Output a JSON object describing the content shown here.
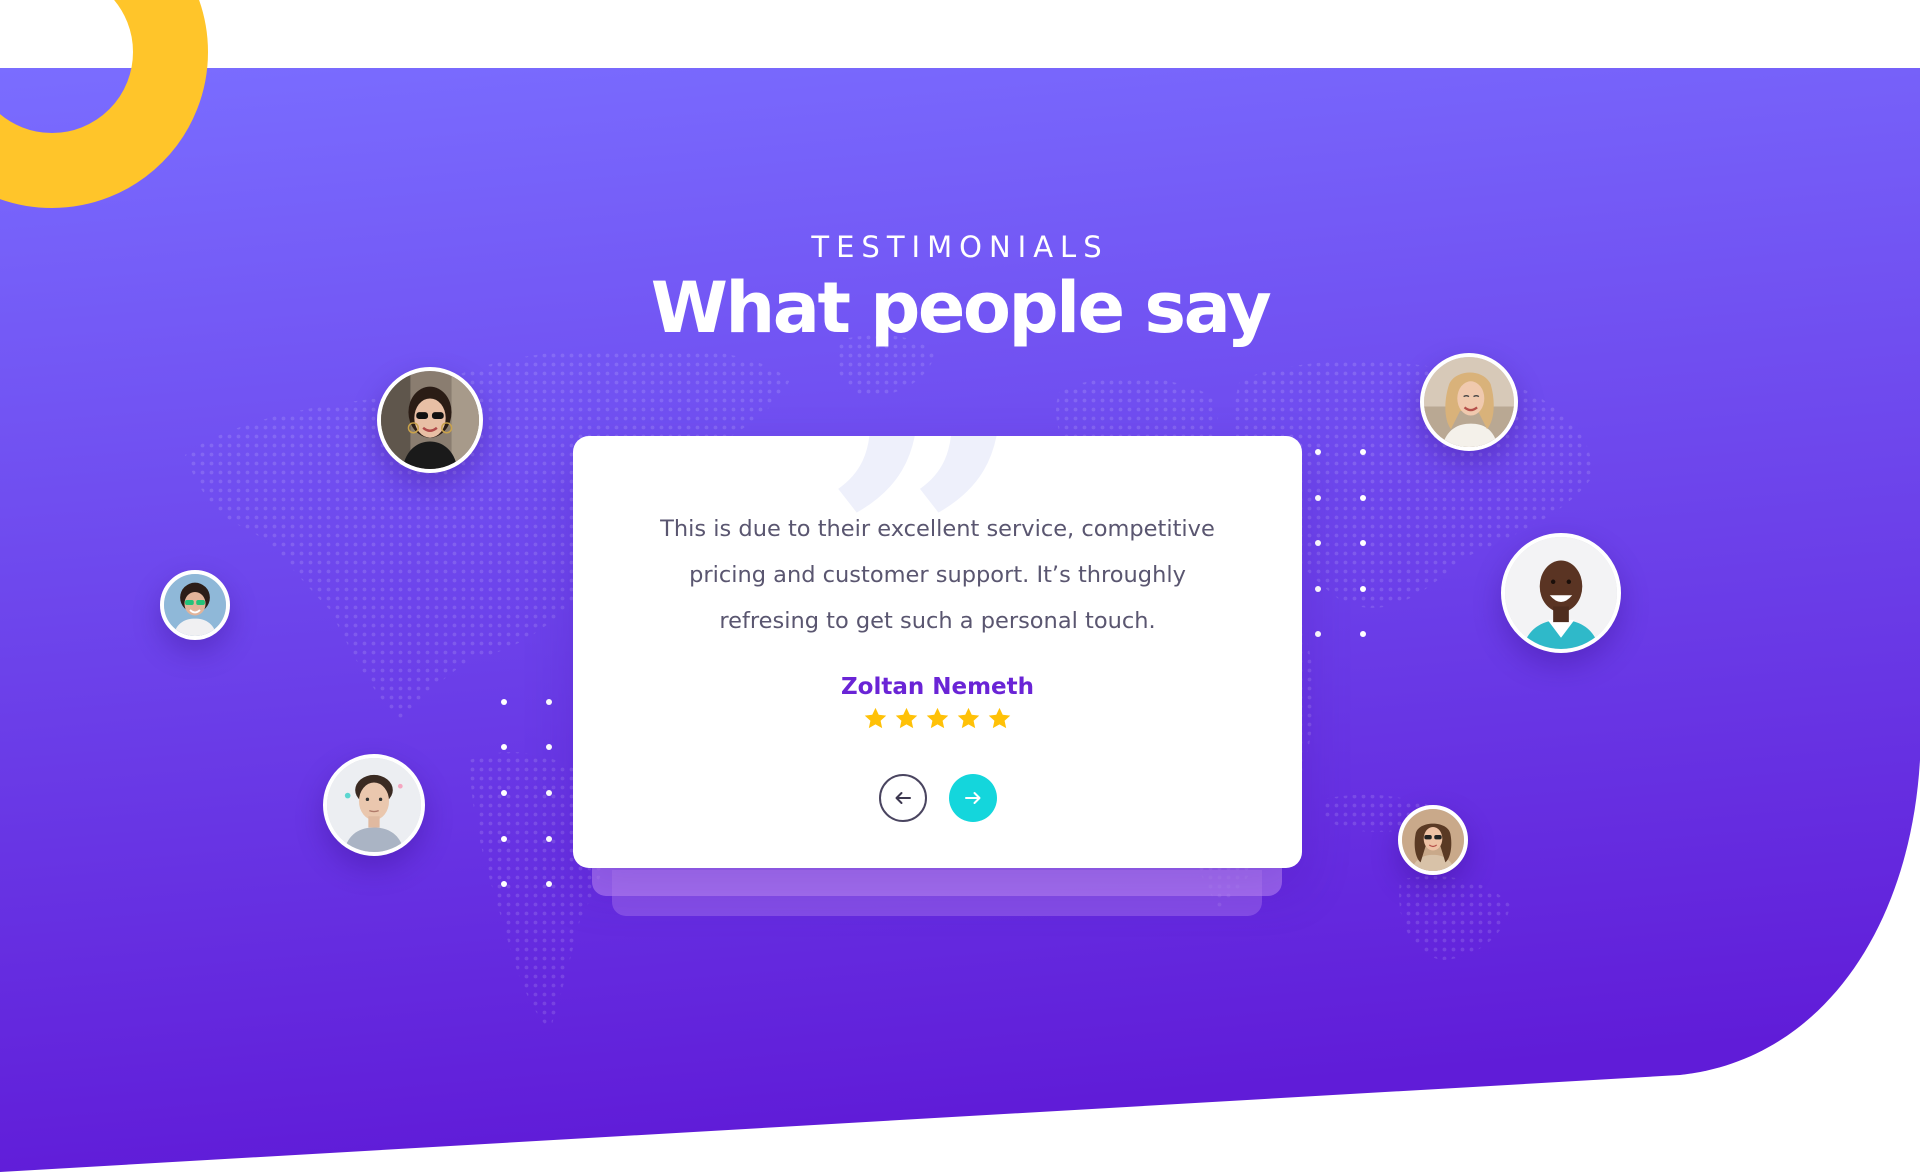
{
  "section": {
    "eyebrow": "TESTIMONIALS",
    "headline": "What people say"
  },
  "testimonial": {
    "quote_line_1": "This is due to their excellent service, competitive",
    "quote_line_2": "pricing and customer support. It’s throughly",
    "quote_line_3": "refresing to get such a personal touch.",
    "author": "Zoltan Nemeth",
    "rating": 5,
    "rating_max": 5
  },
  "navigation": {
    "prev_icon": "arrow-left-icon",
    "next_icon": "arrow-right-icon"
  },
  "colors": {
    "gradient_top": "#7a6dff",
    "gradient_bottom": "#601cd8",
    "accent_yellow": "#ffc52a",
    "accent_cyan": "#14d6dc",
    "author_purple": "#6a24d6",
    "star_yellow": "#ffc107",
    "quote_text": "#5a5670"
  },
  "avatars": [
    {
      "name": "avatar-woman-sunglasses-hoops"
    },
    {
      "name": "avatar-woman-green-sunglasses"
    },
    {
      "name": "avatar-young-man"
    },
    {
      "name": "avatar-woman-blonde"
    },
    {
      "name": "avatar-man-smiling"
    },
    {
      "name": "avatar-woman-brunette"
    }
  ]
}
